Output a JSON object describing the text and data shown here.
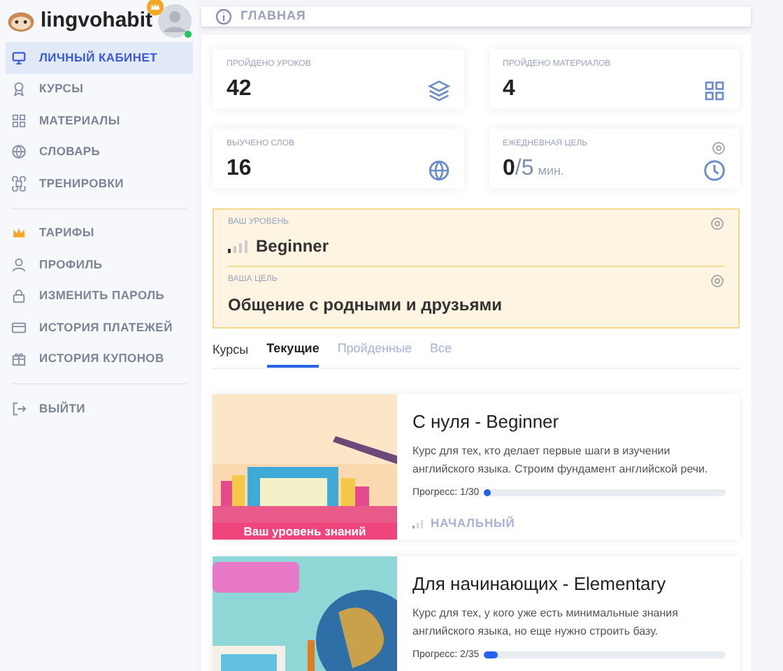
{
  "brand": {
    "name": "lingvohabit"
  },
  "sidebar": {
    "items": [
      {
        "label": "ЛИЧНЫЙ КАБИНЕТ",
        "selected": true
      },
      {
        "label": "КУРСЫ",
        "selected": false
      },
      {
        "label": "МАТЕРИАЛЫ",
        "selected": false
      },
      {
        "label": "СЛОВАРЬ",
        "selected": false
      },
      {
        "label": "ТРЕНИРОВКИ",
        "selected": false
      },
      {
        "label": "ТАРИФЫ",
        "selected": false
      },
      {
        "label": "ПРОФИЛЬ",
        "selected": false
      },
      {
        "label": "ИЗМЕНИТЬ ПАРОЛЬ",
        "selected": false
      },
      {
        "label": "ИСТОРИЯ ПЛАТЕЖЕЙ",
        "selected": false
      },
      {
        "label": "ИСТОРИЯ КУПОНОВ",
        "selected": false
      },
      {
        "label": "ВЫЙТИ",
        "selected": false
      }
    ]
  },
  "breadcrumb": "ГЛАВНАЯ",
  "stats": [
    {
      "label": "ПРОЙДЕНО УРОКОВ",
      "value": "42"
    },
    {
      "label": "ПРОЙДЕНО МАТЕРИАЛОВ",
      "value": "4"
    },
    {
      "label": "ВЫУЧЕНО СЛОВ",
      "value": "16"
    },
    {
      "label": "ЕЖЕДНЕВНАЯ ЦЕЛЬ",
      "value": "0",
      "goal": "/5",
      "unit": "мин."
    }
  ],
  "level_panel": {
    "level_label": "ВАШ УРОВЕНЬ",
    "level": "Beginner",
    "goal_label": "ВАША ЦЕЛЬ",
    "goal": "Общение с родными и друзьями"
  },
  "tabs_title": "Курсы",
  "tabs": [
    {
      "label": "Текущие",
      "selected": true
    },
    {
      "label": "Пройденные",
      "selected": false
    },
    {
      "label": "Все",
      "selected": false
    }
  ],
  "courses": [
    {
      "title": "С нуля - Beginner",
      "description": "Курс для тех, кто делает первые шаги в изучении английского языка. Строим фундамент английской речи.",
      "progress": "Прогресс: 1/30",
      "level": 0.033,
      "difficulty": "НАЧАЛЬНЫЙ",
      "banner": "Ваш уровень знаний",
      "kind": "warm"
    },
    {
      "title": "Для начинающих - Elementary",
      "description": "Курс для тех, у кого уже есть минимальные знания английского языка, но еще нужно строить базу.",
      "progress": "Прогресс: 2/35",
      "level": 0.057,
      "kind": "cool"
    }
  ]
}
